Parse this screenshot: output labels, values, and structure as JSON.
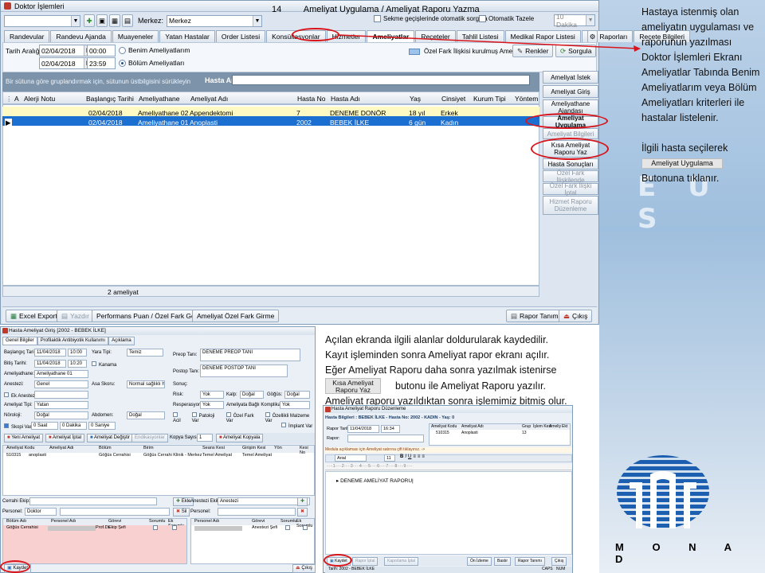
{
  "slide": {
    "page_number": "14",
    "title": "Ameliyat Uygulama  / Ameliyat Raporu Yazma"
  },
  "main_window": {
    "title": "Doktor İşlemleri",
    "merkez_label": "Merkez:",
    "merkez_value": "Merkez",
    "option_1": "Sekme geçişlerinde otomatik sorgula",
    "option_2": "Otomatik Tazele",
    "refresh_value": "10 Dakika",
    "tabs": [
      "Randevular",
      "Randevu Ajanda",
      "Muayeneler",
      "Yatan Hastalar",
      "Order Listesi",
      "Konsültasyonlar",
      "Hizmetler",
      "Ameliyatlar",
      "Reçeteler",
      "Tahlil Listesi",
      "Medikal Rapor Listesi",
      "İlaç Raporları",
      "Reçete Bilgileri"
    ],
    "active_tab": "Ameliyatlar",
    "date_range_label": "Tarih Aralığı:",
    "date_from": "02/04/2018",
    "time_from": "00:00",
    "date_to": "02/04/2018",
    "time_to": "23:59",
    "radio_1": "Benim Ameliyatlarım",
    "radio_2": "Bölüm Ameliyatları",
    "ozel_fark_label": "Özel Fark İlişkisi kurulmuş Ameliyat",
    "renkler_button": "Renkler",
    "sorgula_button": "Sorgula",
    "group_hint": "Bir sütuna göre gruplandırmak için, sütunun üstbilgisini sürükleyin",
    "hasta_ara_label": "Hasta Ara:",
    "columns": [
      "A",
      "Alerji Notu",
      "Başlangıç Tarihi",
      "Ameliyathane",
      "Ameliyat Adı",
      "Hasta No",
      "Hasta Adı",
      "Yaş",
      "Cinsiyet",
      "Kurum Tipi",
      "Yöntem"
    ],
    "rows": [
      {
        "baslangic": "02/04/2018",
        "ameliyathane": "Ameliyathane 02",
        "ameliyat": "Appendektomi",
        "hasta_no": "7",
        "hasta_adi": "DENEME DONÖR",
        "yas": "18 yıl",
        "cinsiyet": "Erkek"
      },
      {
        "baslangic": "02/04/2018",
        "ameliyathane": "Ameliyathane 01",
        "ameliyat": "Anoplasti",
        "hasta_no": "2002",
        "hasta_adi": "BEBEK İLKE",
        "yas": "6 gün",
        "cinsiyet": "Kadın"
      }
    ],
    "row_count": "2 ameliyat",
    "side_buttons": [
      "Ameliyat İstek",
      "Ameliyat Giriş",
      "Ameliyathane Ajandası",
      "Ameliyat Uygulama",
      "Ameliyat Bilgileri",
      "Kısa Ameliyat Raporu Yaz",
      "Hasta Sonuçları",
      "Özel Fark İlişkilende",
      "Özel Fark İlişki İptal",
      "Hizmet Raporu Düzenleme"
    ],
    "bottom_buttons": [
      "Excel Export",
      "Yazdır",
      "Performans Puan / Özel Fark Gör.",
      "Ameliyat Özel Fark Girme",
      "Rapor Tanımı",
      "Çıkış"
    ]
  },
  "annotation_top": {
    "text_1": "Hastaya istenmiş olan ameliyatın uygulaması ve raporunun yazılması Doktor İşlemleri Ekranı Ameliyatlar Tabında Benim Ameliyatlarım veya Bölüm Ameliyatları kriterleri ile hastalar listelenir.",
    "text_2": "İlgili hasta seçilerek",
    "inline_button": "Ameliyat Uygulama",
    "text_3": "Butonuna tıklanır."
  },
  "annotation_bottom": {
    "line_1": "Açılan ekranda ilgili alanlar doldurularak kaydedilir.",
    "line_2": "Kayıt işleminden sonra Ameliyat rapor ekranı açılır.",
    "line_3": "Eğer Ameliyat Raporu daha sonra yazılmak istenirse",
    "inline_button": "Kısa Ameliyat Raporu Yaz",
    "line_4": "butonu ile  Ameliyat Raporu yazılır.",
    "line_5": "Ameliyat raporu yazıldıktan sonra işlemimiz bitmiş olur."
  },
  "dialog_1": {
    "title": "Hasta Ameliyat Giriş [2002 - BEBEK İLKE]",
    "tabs": [
      "Genel Bilgiler",
      "Profilaktik Antibiyotik Kullanımı",
      "Açıklama"
    ],
    "baslangic_label": "Başlangıç Tarihi:",
    "baslangic_date": "11/04/2018",
    "baslangic_time": "10:00",
    "bitis_label": "Bitiş Tarihi:",
    "bitis_date": "11/04/2018",
    "bitis_time": "10:20",
    "ameliyathane_label": "Ameliyathane:",
    "ameliyathane_value": "Ameliyathane 01",
    "anestezi_label": "Anestezi:",
    "anestezi_value": "Genel",
    "ek_anestezi_label": "Ek Anestezi:",
    "ameliyat_tipi_label": "Ameliyat Tipi:",
    "ameliyat_tipi_value": "Yatan",
    "noroloji_label": "Nöroloji:",
    "noroloji_value": "Doğal",
    "skopi_label": "Skopi Var",
    "skopi_saat": "0 Saat",
    "skopi_dk": "0 Dakika",
    "skopi_sn": "0 Saniye",
    "yara_tipi_label": "Yara Tipi:",
    "yara_tipi_value": "Temiz",
    "kanama_label": "Kanama",
    "asa_label": "Asa Skoru:",
    "asa_value": "Normal sağlıklı hasta",
    "risk_label": "Risk:",
    "risk_value": "Yok",
    "rezeksiyon_label": "Rezeksiyon:",
    "rezeksiyon_value": "Yok",
    "abdomen_label": "Abdomen:",
    "abdomen_value": "Doğal",
    "preop_label": "Preop Tanı:",
    "preop_value": "DENEME PREOP TANI",
    "postop_label": "Postop Tanı:",
    "postop_value": "DENEME POSTOP TANI",
    "sonuc_label": "Sonuç:",
    "kalp_label": "Kalp:",
    "kalp_value": "Doğal",
    "gogus_label": "Göğüs:",
    "gogus_value": "Doğal",
    "resp_label": "Resperasyon:",
    "resp_value": "Yok",
    "komp_label": "Ameliyata Bağlı Komplikasyon:",
    "komp_value": "Yok",
    "checks": [
      "Acil",
      "Patoloji Var",
      "Özel Fark Var",
      "Özellikli Malzeme Var",
      "İmplant Var"
    ],
    "toolbar": [
      "Yeni Ameliyat",
      "Ameliyat İptal",
      "Ameliyat Değiştir",
      "Endikasyonlar",
      "Kopya Sayısı:",
      "1",
      "Ameliyat Kopyala"
    ],
    "grid_cols": [
      "Ameliyat Kodu",
      "Ameliyat Adı",
      "Bölüm",
      "Birim",
      "Seans Kesi",
      "Girişim Kesi",
      "Yön",
      "Kesi No"
    ],
    "grid_row": [
      "510315",
      "anoplasti",
      "Göğüs Cerrahisi",
      "Göğüs Cerrahi Klinik - Merkez",
      "Temel Ameliyat",
      "Temel Ameliyat"
    ],
    "cerrahi_label": "Cerrahi Ekip:",
    "anestezi_ekip_label": "Anestezi Ekibi:",
    "anestezi_ekip_value": "Anestezi",
    "personel_label": "Personel:",
    "personel_value": "Doktor",
    "ekle": "Ekle",
    "sil": "Sil",
    "team_cols": [
      "Bölüm Adı",
      "Personel Adı",
      "Görevi",
      "Sorumlu",
      "Ek Sorumlu"
    ],
    "team_row": [
      "Göğüs Cerrahisi",
      "Prof.Dr.",
      "Ekip Şefi"
    ],
    "team2_cols": [
      "Personel Adı",
      "Görevi",
      "Sorumlu",
      "Ek Sorumlu"
    ],
    "team2_row": [
      "Anestezi Şefi"
    ],
    "kaydet": "Kaydet",
    "cikis": "Çıkış"
  },
  "dialog_2": {
    "title": "Hasta Ameliyat Raporu Düzenleme",
    "hasta_bilgileri": "Hasta Bilgileri : BEBEK İLKE - Hasta No: 2002 - KADIN - Yaş: 0",
    "rapor_tarihi_label": "Rapor Tarihi:",
    "rapor_date": "11/04/2018",
    "rapor_time": "16:34",
    "rapor_label": "Rapor:",
    "hint": "Medula açıklaması için Ameliyat satırına çift tıklayınız. ->",
    "cols": [
      "Ameliyat Kodu",
      "Ameliyat Adı",
      "Grup",
      "İşlem Kesi",
      "Ameliy",
      "Ekt"
    ],
    "row": [
      "510315",
      "Anoplasti",
      "13"
    ],
    "font": "Arial",
    "font_size": "11",
    "body": "DENEME AMELİYAT RAPORU",
    "buttons": [
      "Kaydet",
      "Rapor İptal",
      "Kaporlama İptal",
      "Ön İzleme",
      "Bastır",
      "Rapor Tanımı",
      "Çıkış"
    ],
    "status": "Tarih: 2002 - BEBEK İLKE",
    "caps": "CAPS",
    "num": "NUM"
  },
  "logo": {
    "text": "M O N A D",
    "color": "#1c5fb0"
  },
  "colors": {
    "highlight_red": "#d9151b",
    "selected_row": "#1b6fd0",
    "yellow_row": "#fff9c4",
    "header_blue": "#7d93aa"
  }
}
